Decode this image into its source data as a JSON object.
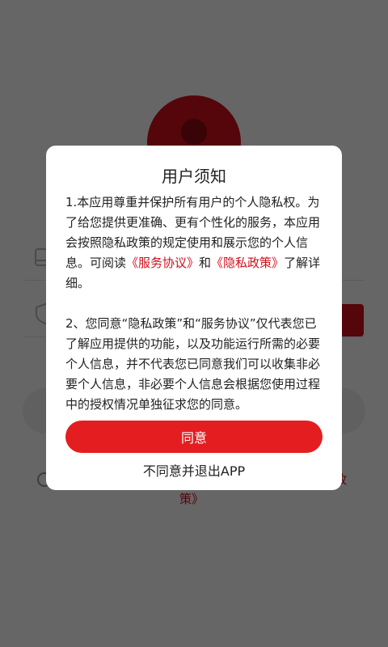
{
  "background": {
    "agreement_tail_1": "政",
    "agreement_tail_2": "策》"
  },
  "dialog": {
    "title": "用户须知",
    "para1_prefix": "1.本应用尊重并保护所有用户的个人隐私权。为了给您提供更准确、更有个性化的服务，本应用会按照隐私政策的规定使用和展示您的个人信息。可阅读",
    "service_link": "《服务协议》",
    "and": "和",
    "privacy_link": "《隐私政策》",
    "para1_suffix": "了解详细。",
    "para2": "2、您同意“隐私政策”和“服务协议”仅代表您已了解应用提供的功能，以及功能运行所需的必要个人信息，并不代表您已同意我们可以收集非必要个人信息，非必要个人信息会根据您使用过程中的授权情况单独征求您的同意。",
    "agree_label": "同意",
    "disagree_label": "不同意并退出APP"
  },
  "colors": {
    "brand_red": "#e41e20",
    "link_red": "#d10f1c"
  }
}
